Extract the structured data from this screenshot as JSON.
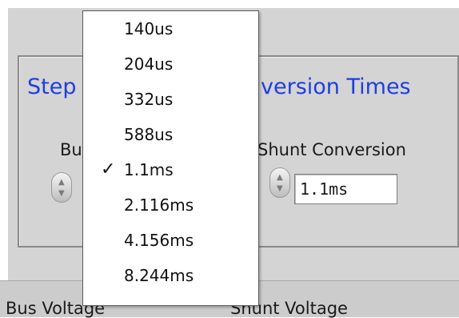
{
  "panel": {
    "group_title_left": "Step",
    "group_title_right": "version Times",
    "bus_label": "Bu",
    "shunt_label": "Shunt Conversion",
    "shunt_value": "1.1ms",
    "bottom_bus_label": "Bus Voltage",
    "bottom_shunt_label": "Shunt Voltage"
  },
  "dropdown": {
    "selected": "1.1ms",
    "check_mark": "✓",
    "items": [
      {
        "label": "140us",
        "checked": false
      },
      {
        "label": "204us",
        "checked": false
      },
      {
        "label": "332us",
        "checked": false
      },
      {
        "label": "588us",
        "checked": false
      },
      {
        "label": "1.1ms",
        "checked": true
      },
      {
        "label": "2.116ms",
        "checked": false
      },
      {
        "label": "4.156ms",
        "checked": false
      },
      {
        "label": "8.244ms",
        "checked": false
      }
    ]
  },
  "icons": {
    "spinner_up": "spinner-up-icon",
    "spinner_down": "spinner-down-icon",
    "check": "check-icon"
  },
  "colors": {
    "group_title": "#1f3ee0",
    "panel_background": "#d4d4d4"
  }
}
